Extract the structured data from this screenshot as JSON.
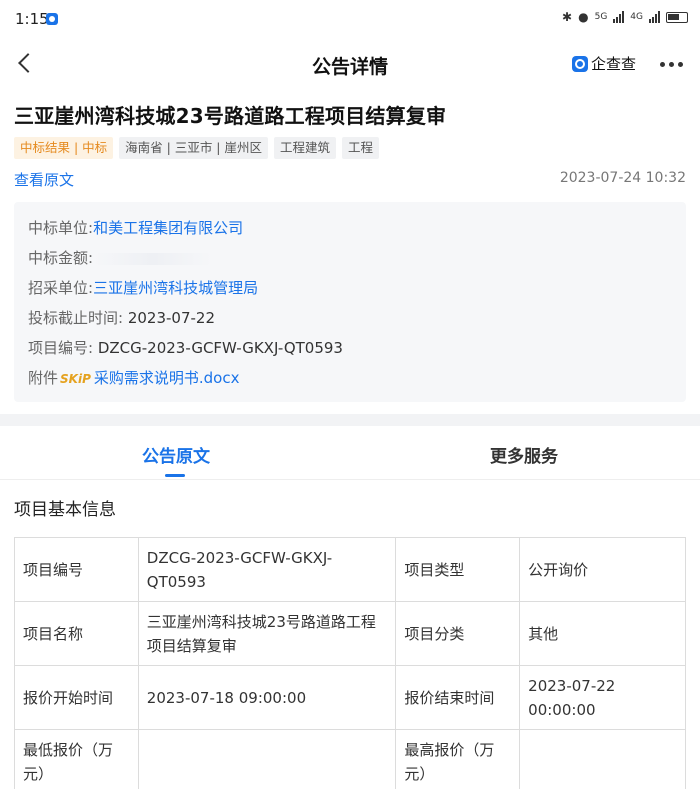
{
  "status_bar": {
    "time": "1:15",
    "net_5g": "5G",
    "net_4g": "4G"
  },
  "nav": {
    "title": "公告详情",
    "brand": "企查查"
  },
  "doc": {
    "title": "三亚崖州湾科技城23号路道路工程项目结算复审",
    "tags": [
      {
        "text": "中标结果 | 中标",
        "style": "orange"
      },
      {
        "text": "海南省 | 三亚市 | 崖州区",
        "style": "gray"
      },
      {
        "text": "工程建筑",
        "style": "gray"
      },
      {
        "text": "工程",
        "style": "gray"
      }
    ],
    "view_original": "查看原文",
    "date": "2023-07-24 10:32"
  },
  "info": {
    "winner_label": "中标单位:",
    "winner_value": "和美工程集团有限公司",
    "amount_label": "中标金额:",
    "buyer_label": "招采单位:",
    "buyer_value": "三亚崖州湾科技城管理局",
    "deadline_label": "投标截止时间:",
    "deadline_value": "2023-07-22",
    "project_no_label": "项目编号:",
    "project_no_value": "DZCG-2023-GCFW-GKXJ-QT0593",
    "attachment_label": "附件",
    "attachment_badge": "SKiP",
    "attachment_value": "采购需求说明书.docx"
  },
  "tabs": {
    "active": "公告原文",
    "other": "更多服务"
  },
  "section": {
    "title": "项目基本信息"
  },
  "table": [
    [
      "项目编号",
      "DZCG-2023-GCFW-GKXJ-QT0593",
      "项目类型",
      "公开询价"
    ],
    [
      "项目名称",
      "三亚崖州湾科技城23号路道路工程项目结算复审",
      "项目分类",
      "其他"
    ],
    [
      "报价开始时间",
      "2023-07-18 09:00:00",
      "报价结束时间",
      "2023-07-22 00:00:00"
    ],
    [
      "最低报价（万元）",
      "",
      "最高报价（万元）",
      ""
    ]
  ],
  "colors": {
    "accent": "#1a73e8",
    "tag_orange": "#e58a1f"
  }
}
